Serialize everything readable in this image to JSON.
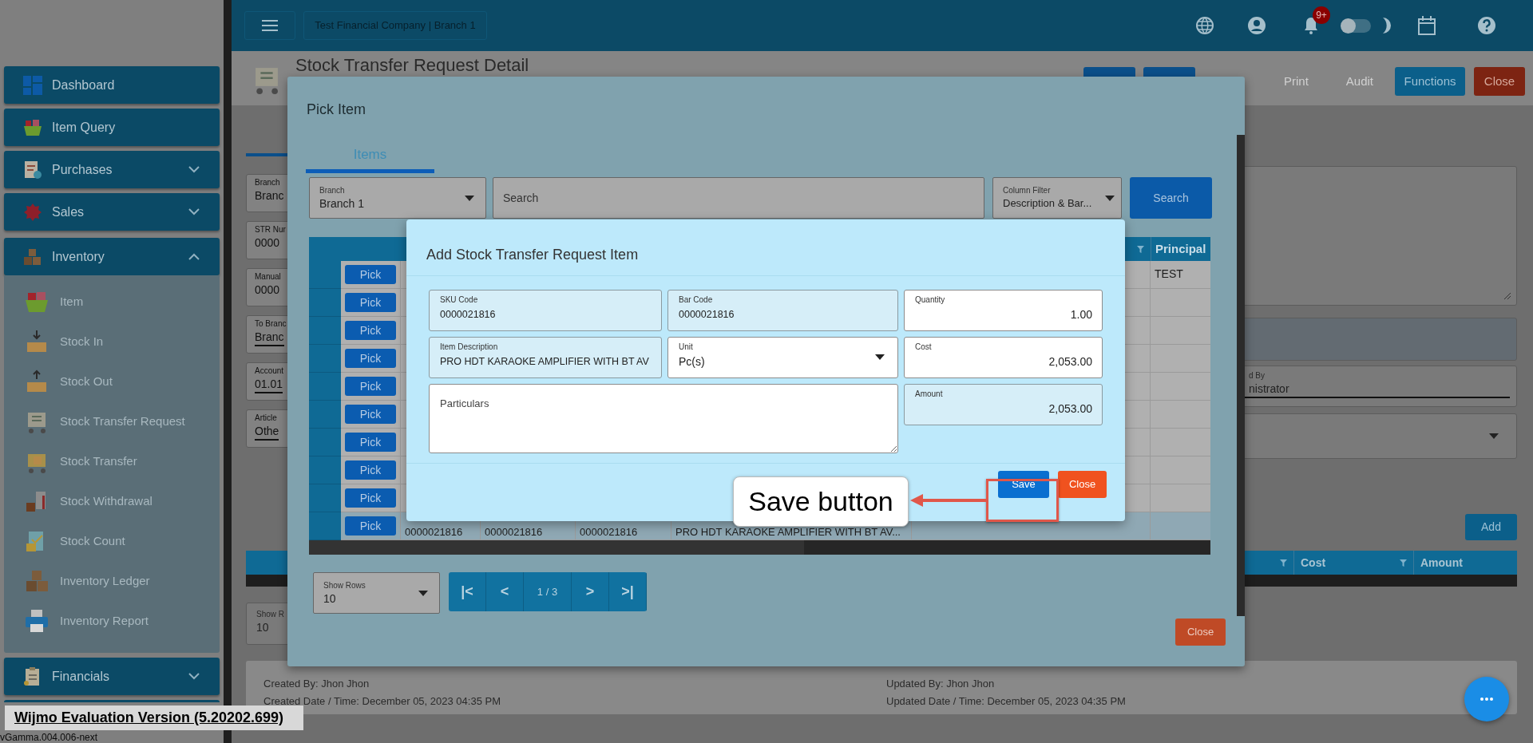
{
  "topbar": {
    "company": "Test Financial Company | Branch 1",
    "notification_count": "9+",
    "dark_mode": false
  },
  "sidebar": {
    "items": [
      {
        "label": "Dashboard"
      },
      {
        "label": "Item Query"
      },
      {
        "label": "Purchases",
        "expanded": false
      },
      {
        "label": "Sales",
        "expanded": false
      },
      {
        "label": "Inventory",
        "expanded": true,
        "children": [
          {
            "label": "Item"
          },
          {
            "label": "Stock In"
          },
          {
            "label": "Stock Out"
          },
          {
            "label": "Stock Transfer Request"
          },
          {
            "label": "Stock Transfer"
          },
          {
            "label": "Stock Withdrawal"
          },
          {
            "label": "Stock Count"
          },
          {
            "label": "Inventory Ledger"
          },
          {
            "label": "Inventory Report"
          }
        ]
      },
      {
        "label": "Financials",
        "expanded": false
      }
    ]
  },
  "evaluation_notice": "Wijmo Evaluation Version (5.20202.699)",
  "version": "vGamma.004.006-next",
  "page": {
    "title": "Stock Transfer Request Detail",
    "toolbar": [
      {
        "label": "Print",
        "kind": "text"
      },
      {
        "label": "Audit",
        "kind": "text"
      },
      {
        "label": "Functions",
        "kind": "primary"
      },
      {
        "label": "Close",
        "kind": "danger"
      }
    ],
    "left_fields": [
      {
        "label": "Branch",
        "value": "Branc",
        "kind": "readonly"
      },
      {
        "label": "STR Nur",
        "value": "0000",
        "kind": "readonly"
      },
      {
        "label": "Manual",
        "value": "0000",
        "kind": "readonly"
      },
      {
        "label": "To Branc",
        "value": "Branc",
        "kind": "editable"
      },
      {
        "label": "Account",
        "value": "01.01",
        "kind": "editable"
      },
      {
        "label": "Article",
        "value": "Othe",
        "kind": "editable"
      }
    ],
    "approved_field": {
      "label": "d By",
      "value": "nistrator"
    },
    "add_button": "Add",
    "detail_table": {
      "columns": [
        "Cost",
        "Amount"
      ]
    },
    "show_rows": {
      "label": "Show R",
      "value": "10"
    },
    "footer": {
      "created_by": "Created By: Jhon Jhon",
      "created_date": "Created Date / Time: December 05, 2023 04:35 PM",
      "updated_by": "Updated By: Jhon Jhon",
      "updated_date": "Updated Date / Time: December 05, 2023 04:35 PM"
    }
  },
  "pick_modal": {
    "title": "Pick Item",
    "tabs": [
      {
        "label": "Items",
        "selected": true
      }
    ],
    "branch": {
      "label": "Branch",
      "value": "Branch 1"
    },
    "search": {
      "placeholder": "Search"
    },
    "column_filter": {
      "label": "Column Filter",
      "value": "Description & Bar..."
    },
    "search_button": "Search",
    "grid": {
      "last_column": "Principal",
      "rows": [
        {
          "action": "Pick",
          "selected": false,
          "principal": "TEST"
        },
        {
          "action": "Pick",
          "selected": false
        },
        {
          "action": "Pick",
          "selected": false
        },
        {
          "action": "Pick",
          "selected": false
        },
        {
          "action": "Pick",
          "selected": false
        },
        {
          "action": "Pick",
          "selected": false
        },
        {
          "action": "Pick",
          "selected": false
        },
        {
          "action": "Pick",
          "selected": false
        },
        {
          "action": "Pick",
          "selected": false
        },
        {
          "action": "Pick",
          "selected": true,
          "sku": "0000021816",
          "bar_code": "0000021816",
          "column_5": "0000021816",
          "description": "PRO HDT KARAOKE AMPLIFIER WITH BT AV..."
        }
      ]
    },
    "show_rows": {
      "label": "Show Rows",
      "value": "10"
    },
    "pager": {
      "first": "|<",
      "prev": "<",
      "page": "1 / 3",
      "next": ">",
      "last": ">|"
    },
    "close_button": "Close"
  },
  "add_modal": {
    "title": "Add Stock Transfer Request Item",
    "fields": [
      {
        "label": "SKU Code",
        "value": "0000021816",
        "kind": "text",
        "readonly": true
      },
      {
        "label": "Bar Code",
        "value": "0000021816",
        "kind": "text",
        "readonly": true
      },
      {
        "label": "Quantity",
        "value": "1.00",
        "kind": "number",
        "readonly": false
      },
      {
        "label": "Item Description",
        "value": "PRO HDT KARAOKE AMPLIFIER WITH BT AV",
        "kind": "text",
        "readonly": true
      },
      {
        "label": "Unit",
        "value": "Pc(s)",
        "kind": "select",
        "readonly": false
      },
      {
        "label": "Cost",
        "value": "2,053.00",
        "kind": "number",
        "readonly": false
      }
    ],
    "particulars": {
      "placeholder": "Particulars"
    },
    "amount": {
      "label": "Amount",
      "value": "2,053.00",
      "readonly": true
    },
    "save_button": "Save",
    "close_button": "Close"
  },
  "annotation": {
    "text": "Save button"
  }
}
